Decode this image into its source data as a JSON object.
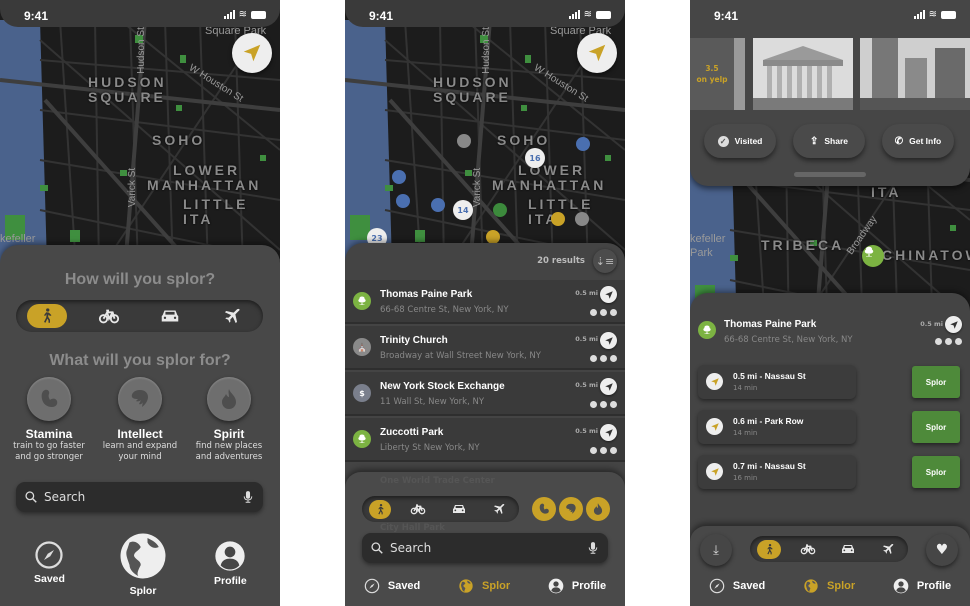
{
  "status": {
    "time": "9:41"
  },
  "colors": {
    "accent": "#c9a227",
    "green": "#4e8a3a",
    "park": "#7cb342",
    "sheet": "#464646"
  },
  "map": {
    "labels": [
      "HUDSON",
      "SQUARE",
      "SOHO",
      "LOWER",
      "MANHATTAN",
      "LITTLE ITA",
      "TRIBECA",
      "CHINATOW"
    ],
    "streets": [
      "Hudson St",
      "W Houston St",
      "Varick St",
      "Broadway",
      "kefeller",
      "Park",
      "Square Park"
    ],
    "pins": [
      {
        "count": "16"
      },
      {
        "count": "14"
      },
      {
        "count": "23"
      }
    ]
  },
  "screen1": {
    "question1": "How will you splor?",
    "modes": [
      "walk-icon",
      "bike-icon",
      "car-icon",
      "plane-icon"
    ],
    "active_mode": 0,
    "question2": "What will you splor for?",
    "goals": [
      {
        "title": "Stamina",
        "desc1": "train to go faster",
        "desc2": "and go stronger",
        "icon": "muscle-icon"
      },
      {
        "title": "Intellect",
        "desc1": "learn and expand",
        "desc2": "your mind",
        "icon": "brain-icon"
      },
      {
        "title": "Spirit",
        "desc1": "find new places",
        "desc2": "and adventures",
        "icon": "flame-icon"
      }
    ],
    "search_placeholder": "Search",
    "nav": {
      "saved": "Saved",
      "splor": "Splor",
      "profile": "Profile"
    }
  },
  "screen2": {
    "results_count": "20 results",
    "results": [
      {
        "name": "Thomas Paine Park",
        "address": "66-68 Centre St, New York, NY",
        "distance": "0.5 mi",
        "type": "park"
      },
      {
        "name": "Trinity Church",
        "address": "Broadway at Wall Street New York, NY",
        "distance": "0.5 mi",
        "type": "church"
      },
      {
        "name": "New York Stock Exchange",
        "address": "11 Wall St, New York, NY",
        "distance": "0.5 mi",
        "type": "bank"
      },
      {
        "name": "Zuccotti Park",
        "address": "Liberty St New York, NY",
        "distance": "0.5 mi",
        "type": "park"
      }
    ],
    "faded_rows": [
      "One World Trade Center",
      "City Hall Park"
    ],
    "search_placeholder": "Search",
    "tabs": {
      "saved": "Saved",
      "splor": "Splor",
      "profile": "Profile"
    }
  },
  "screen3": {
    "rating": "3.5",
    "rating_source": "on yelp",
    "actions": {
      "visited": "Visited",
      "share": "Share",
      "get_info": "Get Info"
    },
    "place": {
      "name": "Thomas Paine Park",
      "address": "66-68 Centre St, New York, NY",
      "distance": "0.5 mi"
    },
    "routes": [
      {
        "title": "0.5 mi - Nassau St",
        "time": "14 min",
        "button": "Splor"
      },
      {
        "title": "0.6 mi - Park Row",
        "time": "14 min",
        "button": "Splor"
      },
      {
        "title": "0.7 mi - Nassau St",
        "time": "16 min",
        "button": "Splor"
      }
    ],
    "tabs": {
      "saved": "Saved",
      "splor": "Splor",
      "profile": "Profile"
    }
  }
}
